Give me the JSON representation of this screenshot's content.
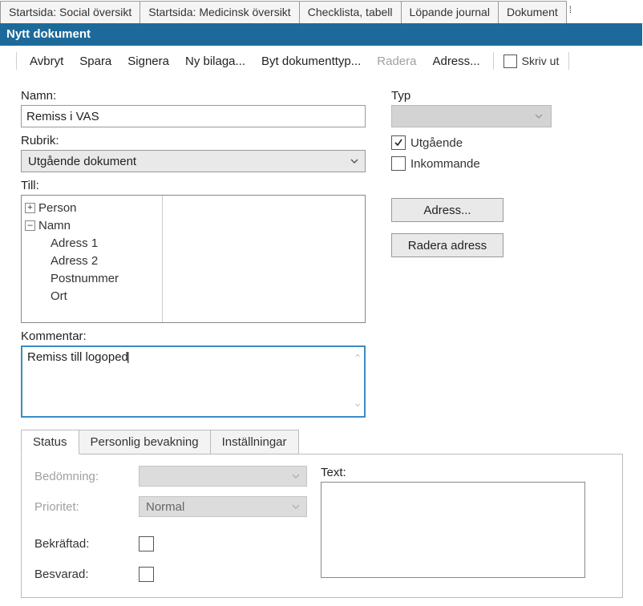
{
  "outer_tabs": {
    "items": [
      {
        "label": "Startsida: Social översikt"
      },
      {
        "label": "Startsida: Medicinsk översikt"
      },
      {
        "label": "Checklista, tabell"
      },
      {
        "label": "Löpande journal"
      },
      {
        "label": "Dokument"
      }
    ]
  },
  "title": "Nytt dokument",
  "toolbar": {
    "avbryt": "Avbryt",
    "spara": "Spara",
    "signera": "Signera",
    "ny_bilaga": "Ny bilaga...",
    "byt_dokumenttyp": "Byt dokumenttyp...",
    "radera": "Radera",
    "adress": "Adress...",
    "skriv_ut": "Skriv ut"
  },
  "form": {
    "namn_label": "Namn:",
    "namn_value": "Remiss i VAS",
    "rubrik_label": "Rubrik:",
    "rubrik_value": "Utgående dokument",
    "till_label": "Till:",
    "tree": {
      "person": "Person",
      "namn": "Namn",
      "adress1": "Adress 1",
      "adress2": "Adress 2",
      "postnummer": "Postnummer",
      "ort": "Ort"
    },
    "kommentar_label": "Kommentar:",
    "kommentar_value": "Remiss till logoped",
    "typ_label": "Typ",
    "utgaende_label": "Utgående",
    "inkommande_label": "Inkommande",
    "adress_btn": "Adress...",
    "radera_adress_btn": "Radera adress"
  },
  "lower": {
    "tabs": {
      "status": "Status",
      "personlig": "Personlig bevakning",
      "installningar": "Inställningar"
    },
    "bedomning_label": "Bedömning:",
    "prioritet_label": "Prioritet:",
    "prioritet_value": "Normal",
    "bekraftad_label": "Bekräftad:",
    "besvarad_label": "Besvarad:",
    "text_label": "Text:"
  }
}
